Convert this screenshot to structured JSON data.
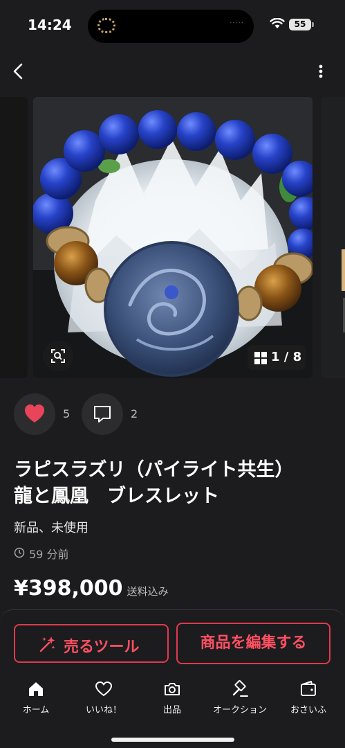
{
  "status_bar": {
    "time": "14:24",
    "battery": "55"
  },
  "gallery": {
    "counter": "1 / 8"
  },
  "reactions": {
    "likes": "5",
    "comments": "2"
  },
  "product": {
    "title": "ラピスラズリ（パイライト共生）\n龍と鳳凰　ブレスレット",
    "condition": "新品、未使用",
    "posted": "59 分前",
    "price": "¥398,000",
    "price_note": "送料込み"
  },
  "actions": {
    "sell_tools": "売るツール",
    "edit": "商品を編集する"
  },
  "tabs": [
    {
      "label": "ホーム",
      "icon": "home-icon",
      "active": true
    },
    {
      "label": "いいね！",
      "icon": "heart-icon"
    },
    {
      "label": "出品",
      "icon": "camera-icon"
    },
    {
      "label": "オークション",
      "icon": "gavel-icon"
    },
    {
      "label": "おさいふ",
      "icon": "wallet-icon"
    }
  ],
  "colors": {
    "background": "#1c1c1e",
    "accent": "#e03a4e",
    "like": "#e8455a"
  }
}
